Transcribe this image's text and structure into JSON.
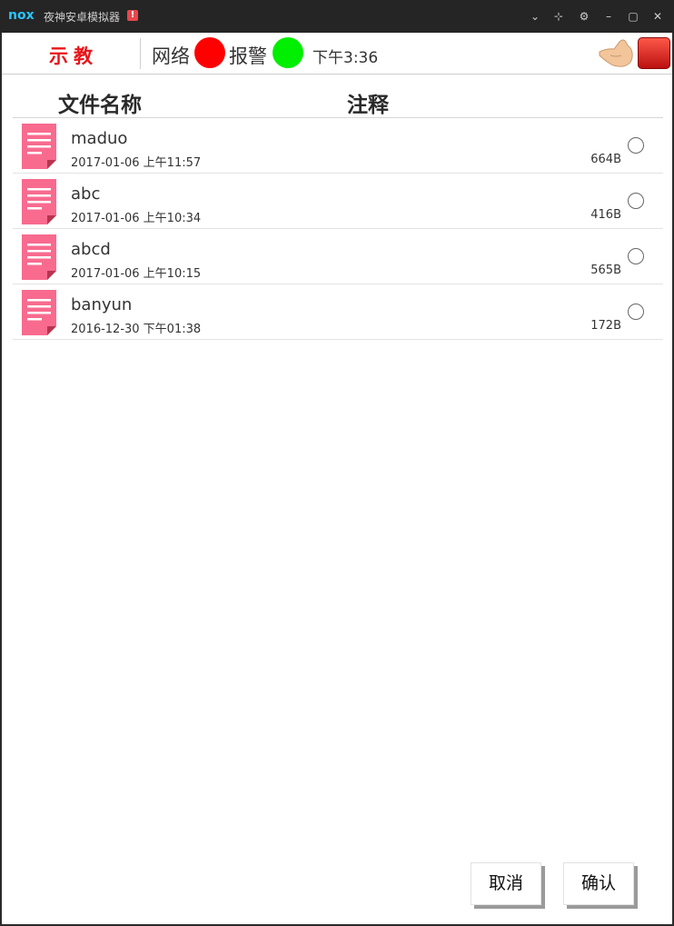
{
  "window": {
    "logo": "nox",
    "title": "夜神安卓模拟器",
    "warning": "!",
    "controls": [
      "⌄",
      "⊹",
      "⚙",
      "–",
      "▢",
      "✕"
    ]
  },
  "topbar": {
    "teach_label": "示教",
    "network_label": "网络",
    "network_color": "#ff0000",
    "alarm_label": "报警",
    "alarm_color": "#00ee00",
    "time": "下午3:36",
    "hand_icon": "hand-icon",
    "red_icon": "red-square-button"
  },
  "headers": {
    "filename": "文件名称",
    "note": "注释"
  },
  "files": [
    {
      "name": "maduo",
      "date": "2017-01-06 上午11:57",
      "size": "664B"
    },
    {
      "name": "abc",
      "date": "2017-01-06 上午10:34",
      "size": "416B"
    },
    {
      "name": "abcd",
      "date": "2017-01-06 上午10:15",
      "size": "565B"
    },
    {
      "name": "banyun",
      "date": "2016-12-30 下午01:38",
      "size": "172B"
    }
  ],
  "buttons": {
    "cancel": "取消",
    "confirm": "确认"
  },
  "colors": {
    "doc_icon": "#f86b8f",
    "teach_text": "#e8151a"
  }
}
